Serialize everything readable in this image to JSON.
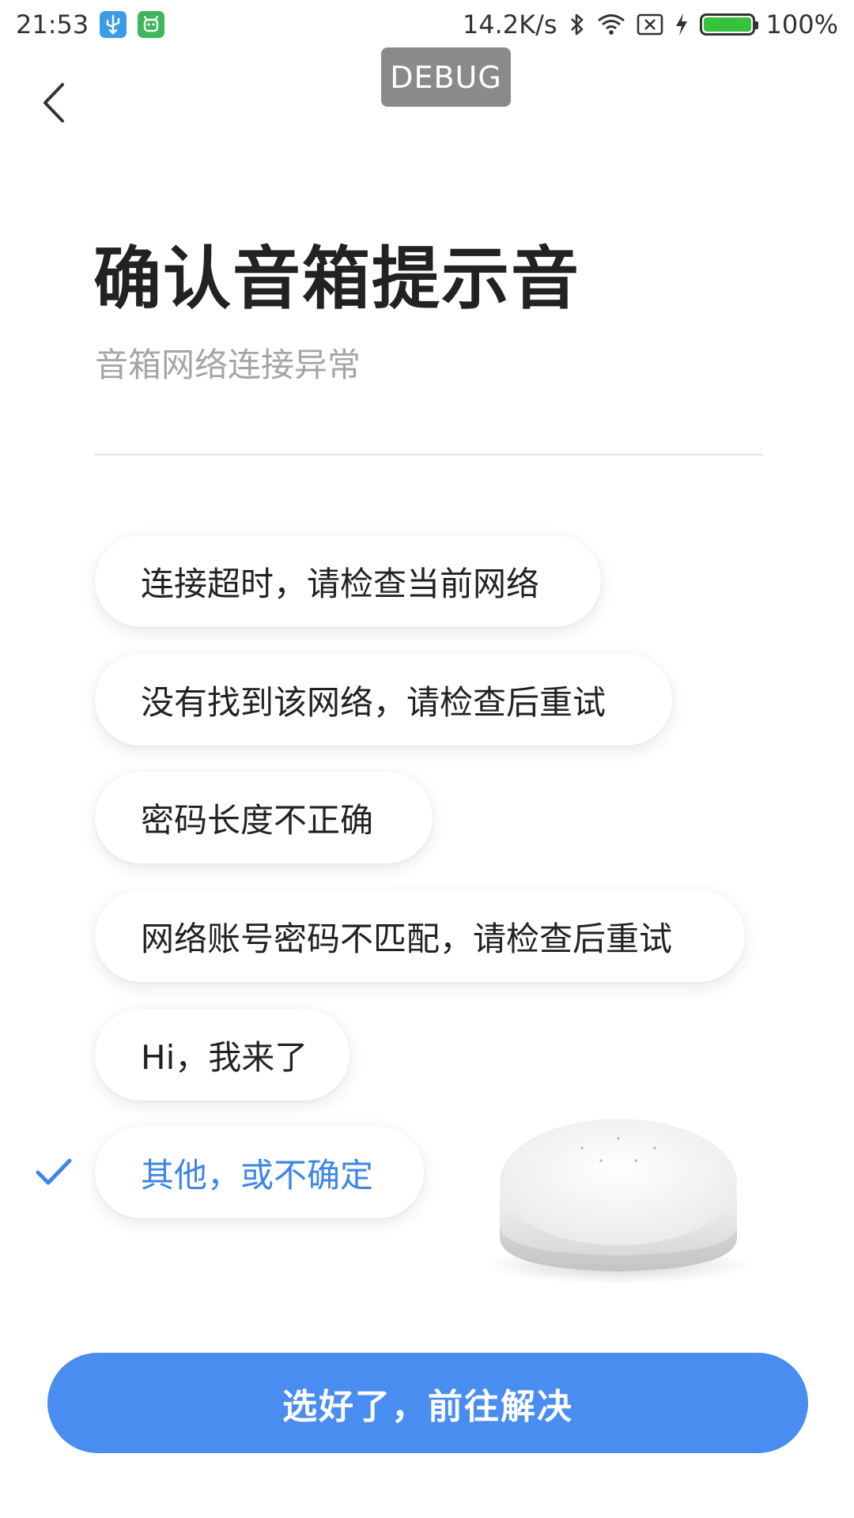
{
  "status_bar": {
    "time": "21:53",
    "net_speed": "14.2K/s",
    "battery_percent": "100%",
    "battery_level": 1.0,
    "icons": [
      "usb-debug-icon",
      "android-icon",
      "bluetooth-icon",
      "wifi-icon",
      "no-sim-icon",
      "charging-icon",
      "battery-icon"
    ]
  },
  "debug_badge": "DEBUG",
  "header": {
    "back_icon": "chevron-left-icon",
    "title": "确认音箱提示音",
    "subtitle": "音箱网络连接异常"
  },
  "options": [
    {
      "label": "连接超时，请检查当前网络",
      "selected": false
    },
    {
      "label": "没有找到该网络，请检查后重试",
      "selected": false
    },
    {
      "label": "密码长度不正确",
      "selected": false
    },
    {
      "label": "网络账号密码不匹配，请检查后重试",
      "selected": false
    },
    {
      "label": "Hi，我来了",
      "selected": false
    },
    {
      "label": "其他，或不确定",
      "selected": true
    }
  ],
  "colors": {
    "accent": "#4a8df0",
    "selected_text": "#3e86e6",
    "title": "#222222",
    "subtitle": "#a5a5a5"
  },
  "primary_button": {
    "label": "选好了，前往解决"
  }
}
